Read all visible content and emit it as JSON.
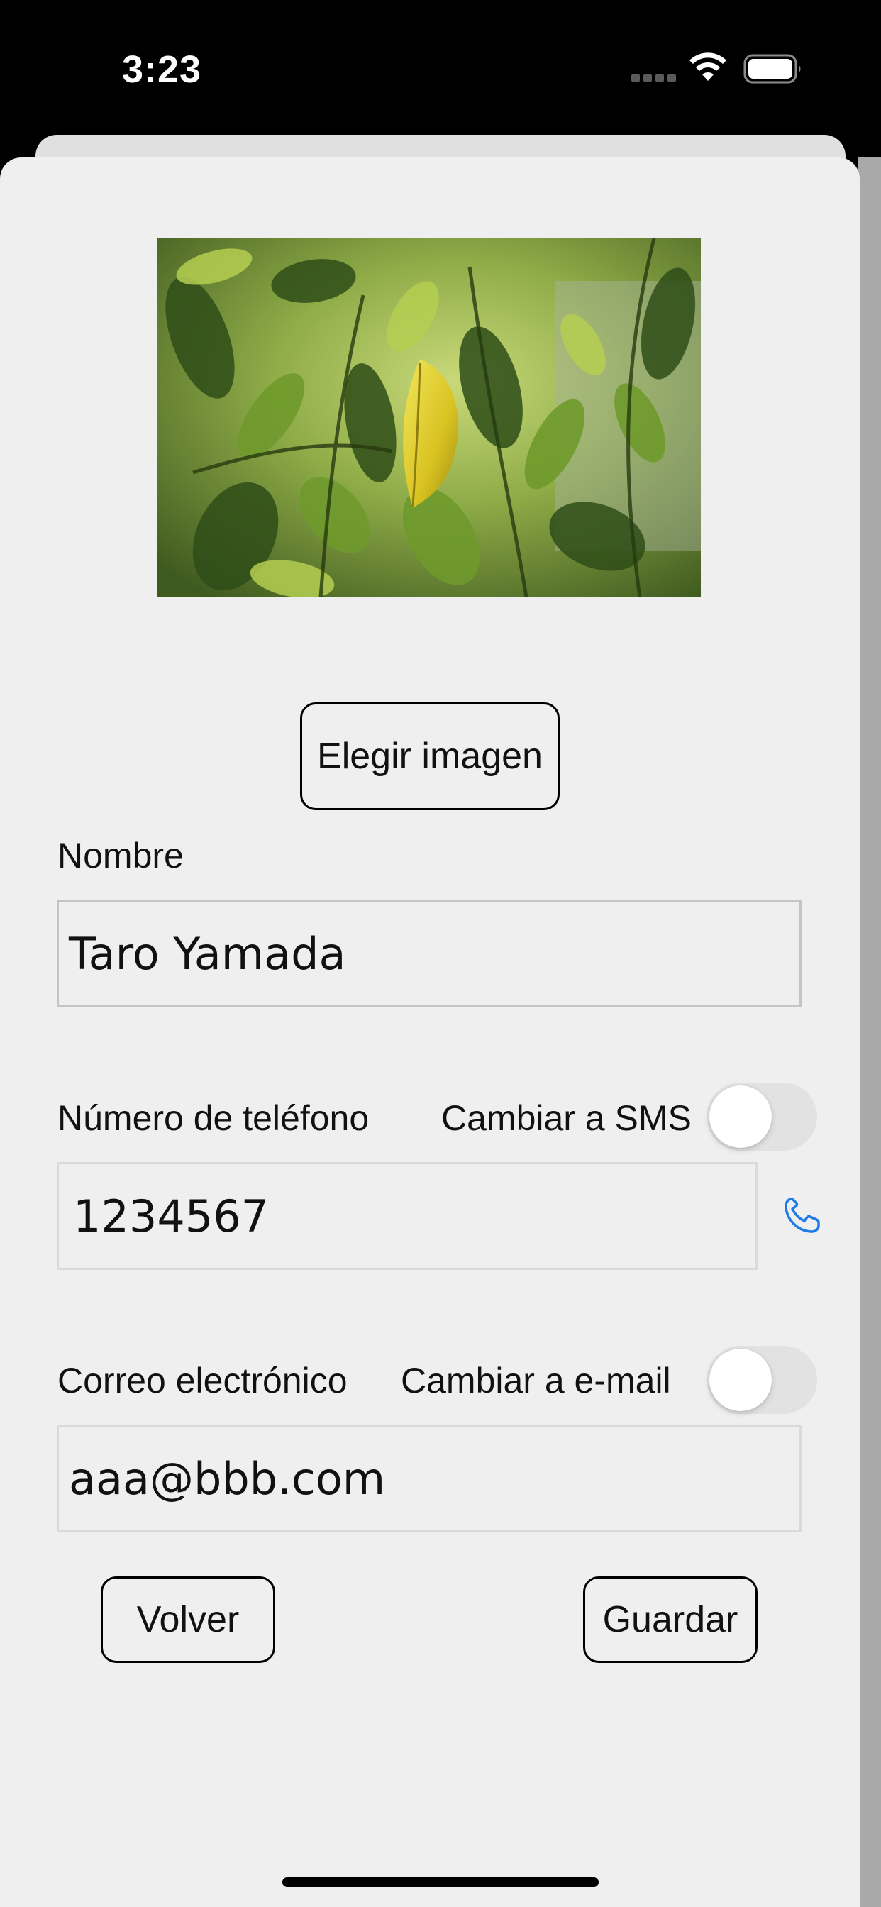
{
  "status_bar": {
    "time": "3:23",
    "icons": [
      "cellular-signal-icon",
      "wifi-icon",
      "battery-icon"
    ]
  },
  "photo": {
    "subject": "leaf-photo"
  },
  "form": {
    "choose_image_label": "Elegir imagen",
    "name": {
      "label": "Nombre",
      "value": "Taro Yamada"
    },
    "phone": {
      "label": "Número de teléfono",
      "toggle_label": "Cambiar a SMS",
      "toggle_on": false,
      "value": "1234567",
      "action_icon": "phone-icon"
    },
    "email": {
      "label": "Correo electrónico",
      "toggle_label": "Cambiar a e-mail",
      "toggle_on": false,
      "value": "aaa@bbb.com"
    },
    "back_label": "Volver",
    "save_label": "Guardar"
  },
  "colors": {
    "accent": "#1e7ae6",
    "sheet_background": "#efefef",
    "toggle_off": "#e2e2e2"
  }
}
